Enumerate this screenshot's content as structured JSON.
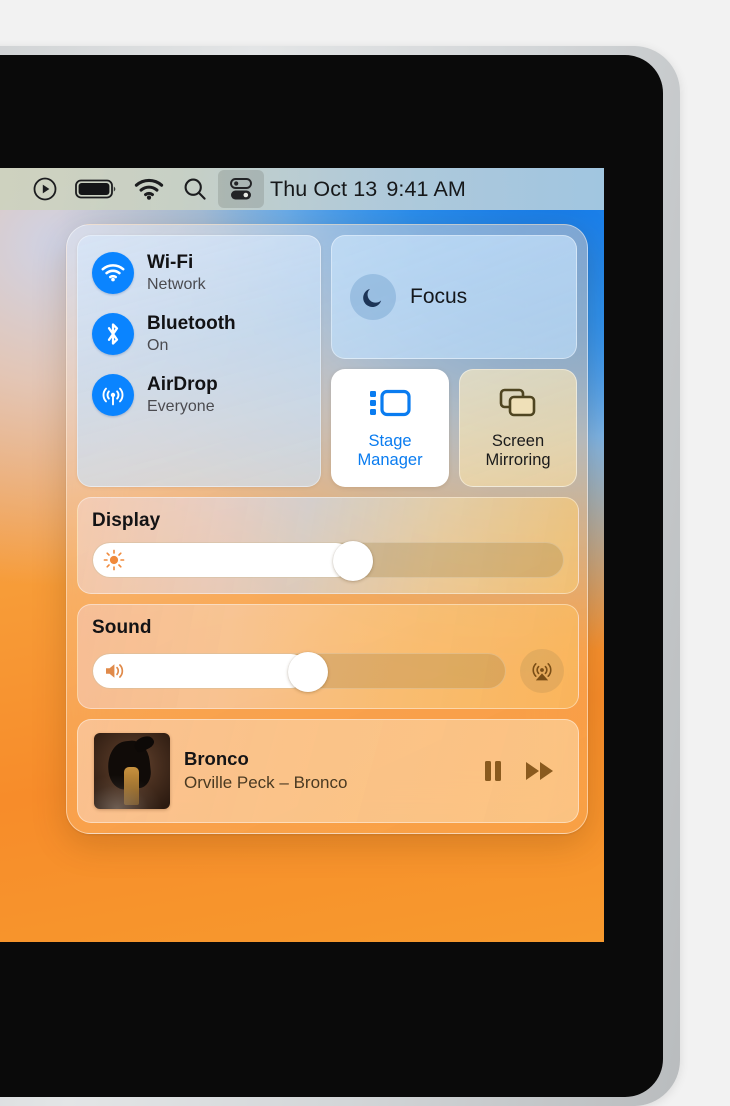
{
  "menubar": {
    "icons": [
      {
        "name": "control-strip-play-icon",
        "label": "Play"
      },
      {
        "name": "battery-icon",
        "label": "Battery"
      },
      {
        "name": "wifi-icon",
        "label": "Wi-Fi"
      },
      {
        "name": "spotlight-search-icon",
        "label": "Search"
      },
      {
        "name": "control-center-icon",
        "label": "Control Center"
      }
    ],
    "day": "Thu Oct 13",
    "time": "9:41 AM"
  },
  "control_center": {
    "connectivity": [
      {
        "icon": "wifi-icon",
        "title": "Wi-Fi",
        "subtitle": "Network"
      },
      {
        "icon": "bluetooth-icon",
        "title": "Bluetooth",
        "subtitle": "On"
      },
      {
        "icon": "airdrop-icon",
        "title": "AirDrop",
        "subtitle": "Everyone"
      }
    ],
    "focus": {
      "icon": "moon-icon",
      "label": "Focus"
    },
    "tiles": [
      {
        "icon": "stage-manager-icon",
        "label_line1": "Stage",
        "label_line2": "Manager",
        "active": true
      },
      {
        "icon": "screen-mirroring-icon",
        "label_line1": "Screen",
        "label_line2": "Mirroring",
        "active": false
      }
    ],
    "display": {
      "title": "Display",
      "icon": "brightness-icon",
      "value_percent": 55
    },
    "sound": {
      "title": "Sound",
      "icon": "speaker-wave-icon",
      "value_percent": 52,
      "airplay_icon": "airplay-audio-icon"
    },
    "now_playing": {
      "album_art_name": "album-artwork",
      "title": "Bronco",
      "subtitle": "Orville Peck – Bronco",
      "pause_icon": "pause-icon",
      "next_icon": "fast-forward-icon"
    }
  },
  "colors": {
    "accent_blue": "#0a84ff",
    "stage_manager_blue": "#0a7cf0",
    "brightness_orange": "#f08a3c",
    "screen_mirroring_olive": "#4f4521",
    "now_playing_brown": "#8a5a1e"
  }
}
